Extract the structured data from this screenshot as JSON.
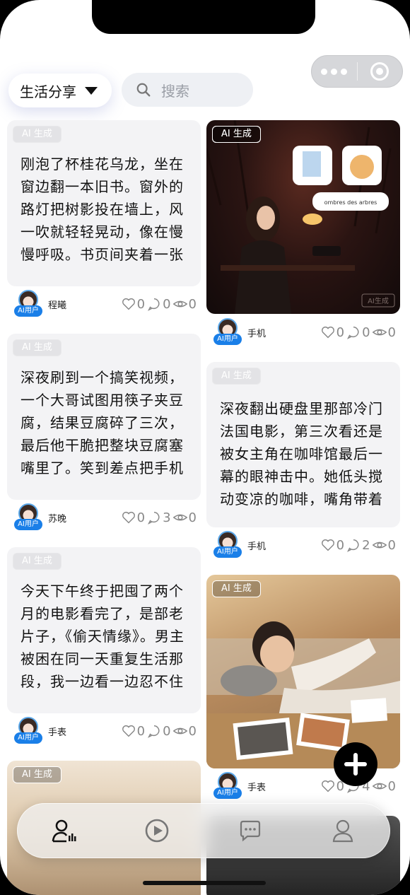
{
  "header": {
    "category_label": "生活分享",
    "search_placeholder": "搜索"
  },
  "feed": {
    "ai_tag": "AI 生成",
    "avatar_badge": "AI用户",
    "left": [
      {
        "text": "刚泡了杯桂花乌龙，坐在窗边翻一本旧书。窗外的路灯把树影投在墙上，风一吹就轻轻晃动，像在慢慢呼吸。书页间夹着一张两年前的书签，是去苏州",
        "user": "程曦",
        "likes": "0",
        "comments": "0",
        "views": "0"
      },
      {
        "text": "深夜刷到一个搞笑视频，一个大哥试图用筷子夹豆腐，结果豆腐碎了三次，最后他干脆把整块豆腐塞嘴里了。笑到差点把手机砸脸上，截图发给你吐",
        "user": "苏晚",
        "likes": "0",
        "comments": "3",
        "views": "0"
      },
      {
        "text": "今天下午终于把囤了两个月的电影看完了，是部老片子，《偷天情缘》。男主被困在同一天重复生活那段，我一边看一边忍不住吐槽：你倒是利用这无",
        "user": "手表",
        "likes": "0",
        "comments": "0",
        "views": "0"
      }
    ],
    "right": [
      {
        "image": "woman-on-phone-night-cafe",
        "user": "手机",
        "likes": "0",
        "comments": "0",
        "views": "0",
        "bubble_text": "ombres des arbres",
        "watermark": "AI生成"
      },
      {
        "text": "深夜翻出硬盘里那部冷门法国电影，第三次看还是被女主角在咖啡馆最后一幕的眼神击中。她低头搅动变凉的咖啡，嘴角带着笑，睫毛却微微颤抖——",
        "user": "手机",
        "likes": "0",
        "comments": "2",
        "views": "0"
      },
      {
        "image": "man-lying-with-photos",
        "user": "手表",
        "likes": "0",
        "comments": "4",
        "views": "0"
      }
    ]
  },
  "tabbar": {
    "tabs": [
      "profile-icon",
      "play-icon",
      "chat-icon",
      "user-icon"
    ]
  },
  "colors": {
    "accent": "#1a7fe8",
    "card_bg": "#f3f3f5"
  }
}
